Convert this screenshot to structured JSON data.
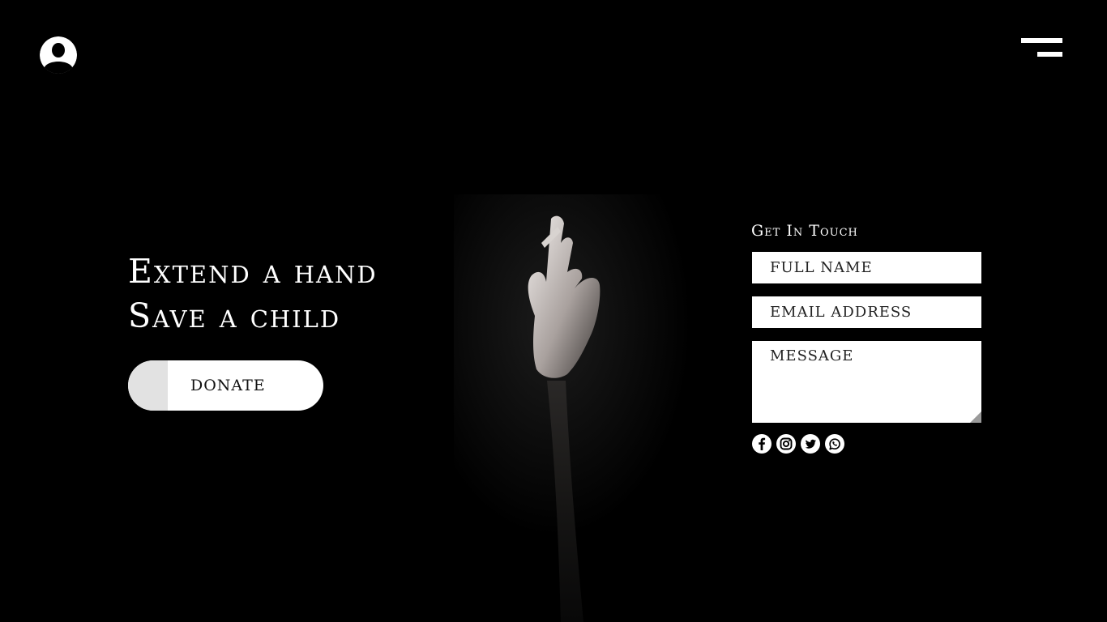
{
  "header": {
    "avatar_icon": "user-avatar-icon",
    "menu_icon": "hamburger-menu-icon"
  },
  "hero": {
    "title_line1": "Extend a hand",
    "title_line2": "Save a child",
    "donate_label": "DONATE"
  },
  "contact": {
    "heading": "Get In Touch",
    "name_placeholder": "FULL NAME",
    "email_placeholder": "EMAIL ADDRESS",
    "message_placeholder": "MESSAGE",
    "social": [
      "facebook-icon",
      "instagram-icon",
      "twitter-icon",
      "whatsapp-icon"
    ]
  },
  "colors": {
    "background": "#000000",
    "foreground": "#ffffff",
    "donate_accent": "#e2e2e2"
  }
}
